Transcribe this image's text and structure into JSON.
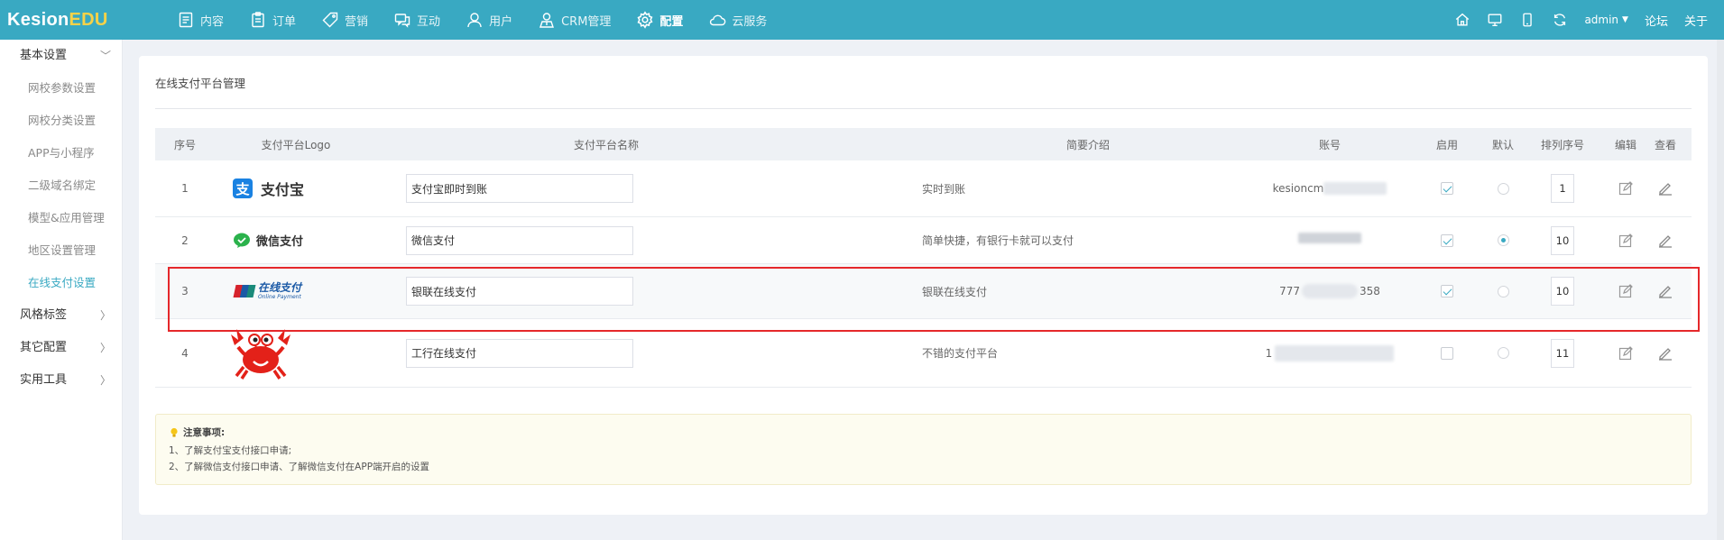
{
  "app": {
    "logo_main": "Kesion",
    "logo_accent": "EDU",
    "accent_color": "#39a9c2"
  },
  "topnav": [
    {
      "label": "内容",
      "icon": "document-icon"
    },
    {
      "label": "订单",
      "icon": "clipboard-icon"
    },
    {
      "label": "营销",
      "icon": "tag-icon"
    },
    {
      "label": "互动",
      "icon": "chat-icon"
    },
    {
      "label": "用户",
      "icon": "user-icon"
    },
    {
      "label": "CRM管理",
      "icon": "crm-icon"
    },
    {
      "label": "配置",
      "icon": "gear-icon",
      "active": true
    },
    {
      "label": "云服务",
      "icon": "cloud-icon"
    }
  ],
  "topright": {
    "user": "admin",
    "forum": "论坛",
    "about": "关于"
  },
  "sidebar": {
    "groups": [
      {
        "label": "基本设置",
        "expanded": true,
        "items": [
          {
            "label": "网校参数设置"
          },
          {
            "label": "网校分类设置"
          },
          {
            "label": "APP与小程序"
          },
          {
            "label": "二级域名绑定"
          },
          {
            "label": "模型&应用管理"
          },
          {
            "label": "地区设置管理"
          },
          {
            "label": "在线支付设置",
            "active": true
          }
        ]
      },
      {
        "label": "风格标签"
      },
      {
        "label": "其它配置"
      },
      {
        "label": "实用工具"
      }
    ]
  },
  "page": {
    "title": "在线支付平台管理"
  },
  "table": {
    "headers": [
      "序号",
      "支付平台Logo",
      "支付平台名称",
      "简要介绍",
      "账号",
      "启用",
      "默认",
      "排列序号",
      "编辑",
      "查看"
    ],
    "rows": [
      {
        "index": "1",
        "logo_text": "支付宝",
        "name": "支付宝即时到账",
        "intro": "实时到账",
        "account_prefix": "kesioncm",
        "account_suffix": "",
        "enabled": true,
        "default": false,
        "order": "1"
      },
      {
        "index": "2",
        "logo_text": "微信支付",
        "name": "微信支付",
        "intro": "简单快捷，有银行卡就可以支付",
        "account_prefix": "",
        "account_suffix": "",
        "enabled": true,
        "default": true,
        "order": "10"
      },
      {
        "index": "3",
        "logo_text": "在线支付",
        "logo_sub": "Online Payment",
        "name": "银联在线支付",
        "intro": "银联在线支付",
        "account_prefix": "777",
        "account_suffix": "358",
        "enabled": true,
        "default": false,
        "order": "10"
      },
      {
        "index": "4",
        "logo_text": "",
        "name": "工行在线支付",
        "intro": "不错的支付平台",
        "account_prefix": "1",
        "account_suffix": "",
        "enabled": false,
        "default": false,
        "order": "11"
      }
    ]
  },
  "notice": {
    "title": "注意事项:",
    "lines": [
      "1、了解支付宝支付接口申请;",
      "2、了解微信支付接口申请、了解微信支付在APP端开启的设置"
    ]
  }
}
